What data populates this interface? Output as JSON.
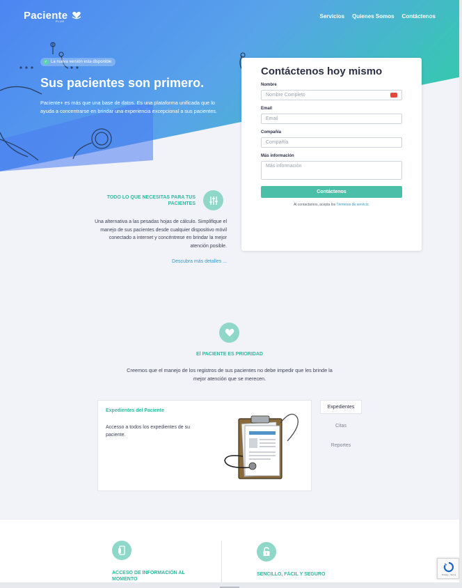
{
  "brand": {
    "name": "Paciente",
    "sub": "PLUS"
  },
  "nav": [
    "Servicios",
    "Quienes Somos",
    "Contáctenos"
  ],
  "hero": {
    "badge": "La nueva versión esta disponible",
    "title": "Sus pacientes son primero.",
    "description": "Paciente+ es más que una base de datos. Es una plataforma unificada que lo ayuda a concentrarse en brindar una experiencia excepcional a sus pacientes."
  },
  "contact_form": {
    "title": "Contáctenos hoy mismo",
    "fields": [
      {
        "label": "Nombre",
        "placeholder": "Nombre Completo"
      },
      {
        "label": "Email",
        "placeholder": "Email"
      },
      {
        "label": "Compañía",
        "placeholder": "Compañía"
      },
      {
        "label": "Más información",
        "placeholder": "Más información"
      }
    ],
    "submit": "Contáctenos",
    "terms_prefix": "Al contactarnos, acepta los",
    "terms_link": "Términos de servicio."
  },
  "feature": {
    "heading": "TODO LO QUE NECESITAS PARA TUS PACIENTES",
    "body": "Una alternativa a las pesadas hojas de cálculo. Simplifique el manejo de sus pacientes desde cualquier dispositivo móvil conectado a internet y concéntrese en brindar la mejor atención posible.",
    "link": "Descubra más detalles ..."
  },
  "priority": {
    "title": "El PACIENTE ES PRIORIDAD",
    "description": "Creemos que el manejo de los registros de sus pacientes no debe impedir que les brinde la mejor atención que se merecen."
  },
  "records": {
    "title": "Expedientes del Paciente",
    "description": "Accesso a todos los expedientes de su paciente."
  },
  "tabs": [
    "Expedientes",
    "Citas",
    "Reportes"
  ],
  "bottom_features": [
    "ACCESO DE INFORMACIÓN AL MOMENTO",
    "SENCILLO, FÁCIL Y SEGURO"
  ],
  "recaptcha": "Privacy - Terms",
  "colors": {
    "accent": "#4bbfa8",
    "hero_blue": "#4f8ff0",
    "hero_green": "#3ec2b7"
  }
}
